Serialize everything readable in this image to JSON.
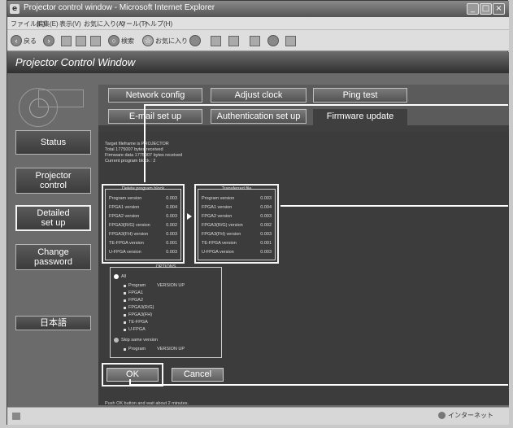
{
  "browser": {
    "title": "Projector control window - Microsoft Internet Explorer",
    "menu": [
      "ファイル(F)",
      "編集(E)",
      "表示(V)",
      "お気に入り(A)",
      "ツール(T)",
      "ヘルプ(H)"
    ],
    "toolbar": {
      "back_label": "戻る",
      "search_label": "検索",
      "favorites_label": "お気に入り"
    },
    "status": {
      "zone_label": "インターネット"
    }
  },
  "app": {
    "title": "Projector Control Window",
    "sidebar": [
      {
        "label": "Status"
      },
      {
        "label": "Projector control"
      },
      {
        "label": "Detailed set up"
      },
      {
        "label": "Change password"
      },
      {
        "label": "日本語"
      }
    ],
    "tabs": [
      {
        "label": "Network config"
      },
      {
        "label": "Adjust clock"
      },
      {
        "label": "Ping test"
      },
      {
        "label": "E-mail set up"
      },
      {
        "label": "Authentication set up"
      },
      {
        "label": "Firmware update"
      }
    ]
  },
  "firmware": {
    "info_lines": [
      "Target fileframe is PROJECTOR",
      "Total 1775007 bytes received",
      "Firmware data 1775007 bytes received",
      "Current program block : 2"
    ],
    "delete_block_title": "Delete program block",
    "transferred_title": "Transferred file",
    "delete_rows": [
      {
        "name": "Program version",
        "value": "0.003"
      },
      {
        "name": "FPGA1 version",
        "value": "0.004"
      },
      {
        "name": "FPGA2 version",
        "value": "0.003"
      },
      {
        "name": "FPGA3(R/G) version",
        "value": "0.002"
      },
      {
        "name": "FPGA3(FH) version",
        "value": "0.003"
      },
      {
        "name": "TE-FPGA version",
        "value": "0.001"
      },
      {
        "name": "U-FPGA version",
        "value": "0.003"
      }
    ],
    "transferred_rows": [
      {
        "name": "Program version",
        "value": "0.003"
      },
      {
        "name": "FPGA1 version",
        "value": "0.004"
      },
      {
        "name": "FPGA2 version",
        "value": "0.003"
      },
      {
        "name": "FPGA3(R/G) version",
        "value": "0.002"
      },
      {
        "name": "FPGA3(FH) version",
        "value": "0.003"
      },
      {
        "name": "TE-FPGA version",
        "value": "0.001"
      },
      {
        "name": "U-FPGA version",
        "value": "0.003"
      }
    ],
    "options_title": "OPTIONS",
    "option_all": "All",
    "option_all_items": [
      {
        "name": "Program",
        "note": "VERSION UP"
      },
      {
        "name": "FPGA1",
        "note": ""
      },
      {
        "name": "FPGA2",
        "note": ""
      },
      {
        "name": "FPGA3(R/G)",
        "note": ""
      },
      {
        "name": "FPGA3(FH)",
        "note": ""
      },
      {
        "name": "TE-FPGA",
        "note": ""
      },
      {
        "name": "U-FPGA",
        "note": ""
      }
    ],
    "option_skip": "Skip same version",
    "option_skip_items": [
      {
        "name": "Program",
        "note": "VERSION UP"
      }
    ],
    "ok_label": "OK",
    "cancel_label": "Cancel",
    "hint": "Push OK button and wait about 2 minutes."
  }
}
